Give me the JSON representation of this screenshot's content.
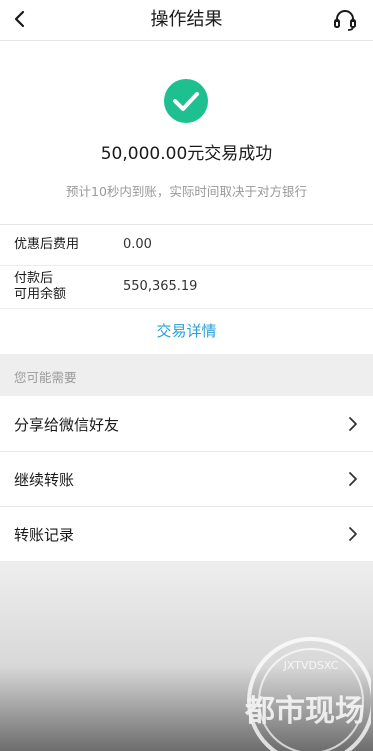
{
  "header": {
    "title": "操作结果"
  },
  "result": {
    "title": "50,000.00元交易成功",
    "note": "预计10秒内到账，实际时间取决于对方银行"
  },
  "info": {
    "fee_label": "优惠后费用",
    "fee_value": "0.00",
    "balance_label_line1": "付款后",
    "balance_label_line2": "可用余额",
    "balance_value": "550,365.19"
  },
  "detail_link": "交易详情",
  "section_title": "您可能需要",
  "menu": [
    {
      "label": "分享给微信好友"
    },
    {
      "label": "继续转账"
    },
    {
      "label": "转账记录"
    }
  ],
  "watermark": {
    "text": "都市现场",
    "subtext": "JXTVDSXC"
  },
  "colors": {
    "success": "#1ec08f",
    "link": "#2a9fd6"
  }
}
